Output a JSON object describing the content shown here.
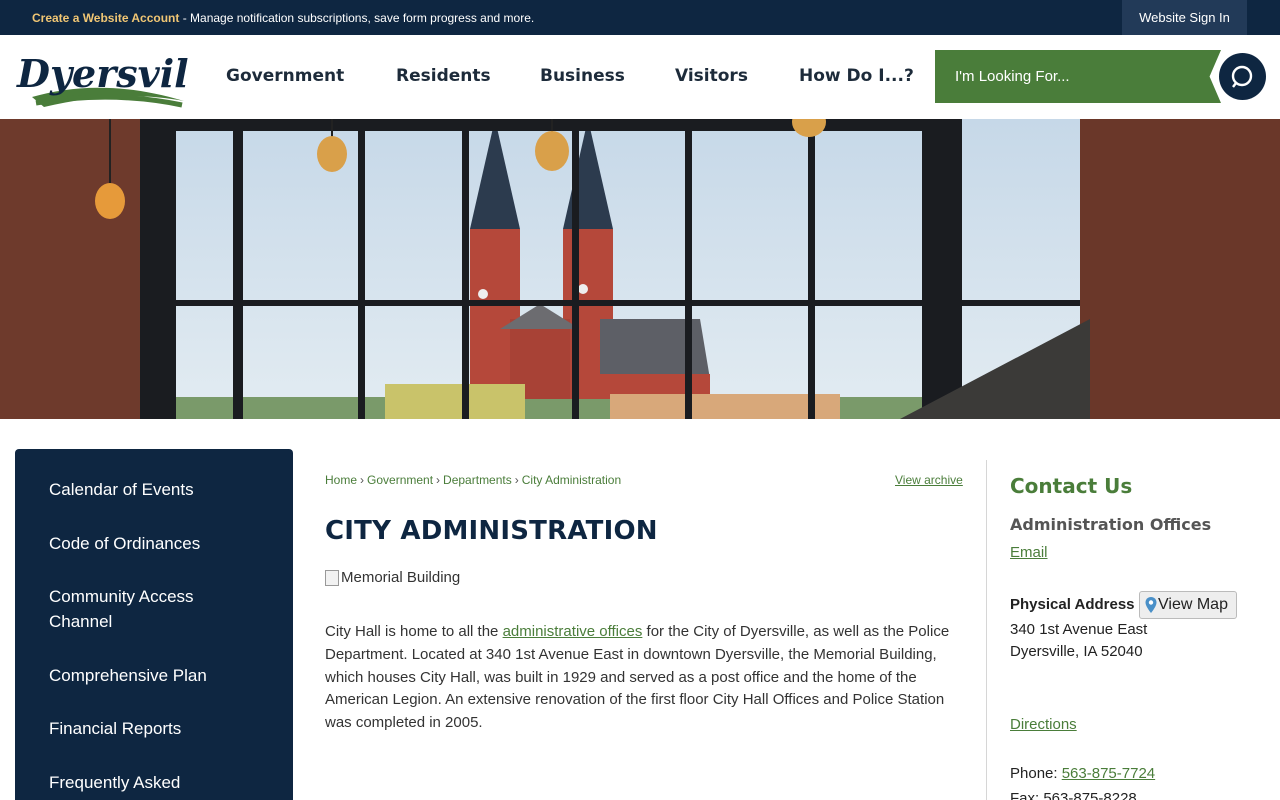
{
  "topbar": {
    "create_account": "Create a Website Account",
    "message": " - Manage notification subscriptions, save form progress and more.",
    "sign_in": "Website Sign In"
  },
  "header": {
    "logo_text": "Dyersville",
    "nav": [
      "Government",
      "Residents",
      "Business",
      "Visitors",
      "How Do I...?"
    ],
    "search_placeholder": "I'm Looking For..."
  },
  "sidebar": {
    "items": [
      "Calendar of Events",
      "Code of Ordinances",
      "Community Access Channel",
      "Comprehensive Plan",
      "Financial Reports",
      "Frequently Asked"
    ]
  },
  "breadcrumb": [
    "Home",
    "Government",
    "Departments",
    "City Administration"
  ],
  "view_archive": "View archive",
  "page_title": "CITY ADMINISTRATION",
  "image_alt": "Memorial Building",
  "body": {
    "before_link": "City Hall is home to all the ",
    "link": "administrative offices",
    "after_link": " for the City of Dyersville, as well as the Police Department. Located at 340 1st Avenue East in downtown Dyersville, the Memorial Building, which houses City Hall, was built in 1929 and served as a post office and the home of the American Legion. An extensive renovation of the first floor City Hall Offices and Police Station was completed in 2005."
  },
  "contact": {
    "title": "Contact Us",
    "office": "Administration Offices",
    "email": "Email",
    "address_label": "Physical Address",
    "view_map": "View Map",
    "street": "340 1st Avenue East",
    "city": "Dyersville, IA 52040",
    "directions": "Directions",
    "phone_label": "Phone: ",
    "phone": "563-875-7724",
    "fax_label": "Fax: ",
    "fax": "563-875-8228"
  },
  "colors": {
    "navy": "#0e2641",
    "green": "#4a7d3a",
    "gold": "#f0c674"
  }
}
